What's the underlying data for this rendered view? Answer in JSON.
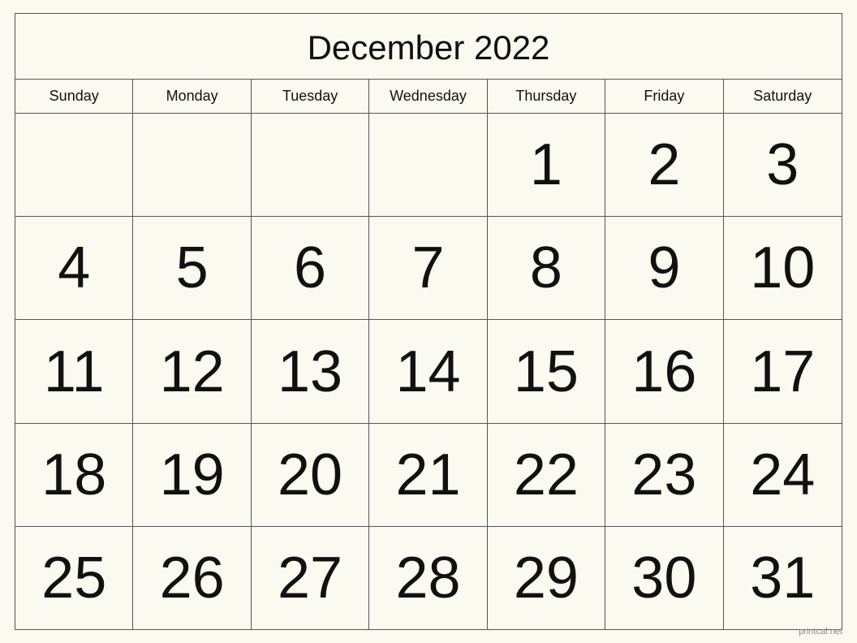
{
  "calendar": {
    "title": "December 2022",
    "days_of_week": [
      "Sunday",
      "Monday",
      "Tuesday",
      "Wednesday",
      "Thursday",
      "Friday",
      "Saturday"
    ],
    "weeks": [
      [
        "",
        "",
        "",
        "",
        "1",
        "2",
        "3"
      ],
      [
        "4",
        "5",
        "6",
        "7",
        "8",
        "9",
        "10"
      ],
      [
        "11",
        "12",
        "13",
        "14",
        "15",
        "16",
        "17"
      ],
      [
        "18",
        "19",
        "20",
        "21",
        "22",
        "23",
        "24"
      ],
      [
        "25",
        "26",
        "27",
        "28",
        "29",
        "30",
        "31"
      ]
    ]
  },
  "watermark": "printcal.net"
}
